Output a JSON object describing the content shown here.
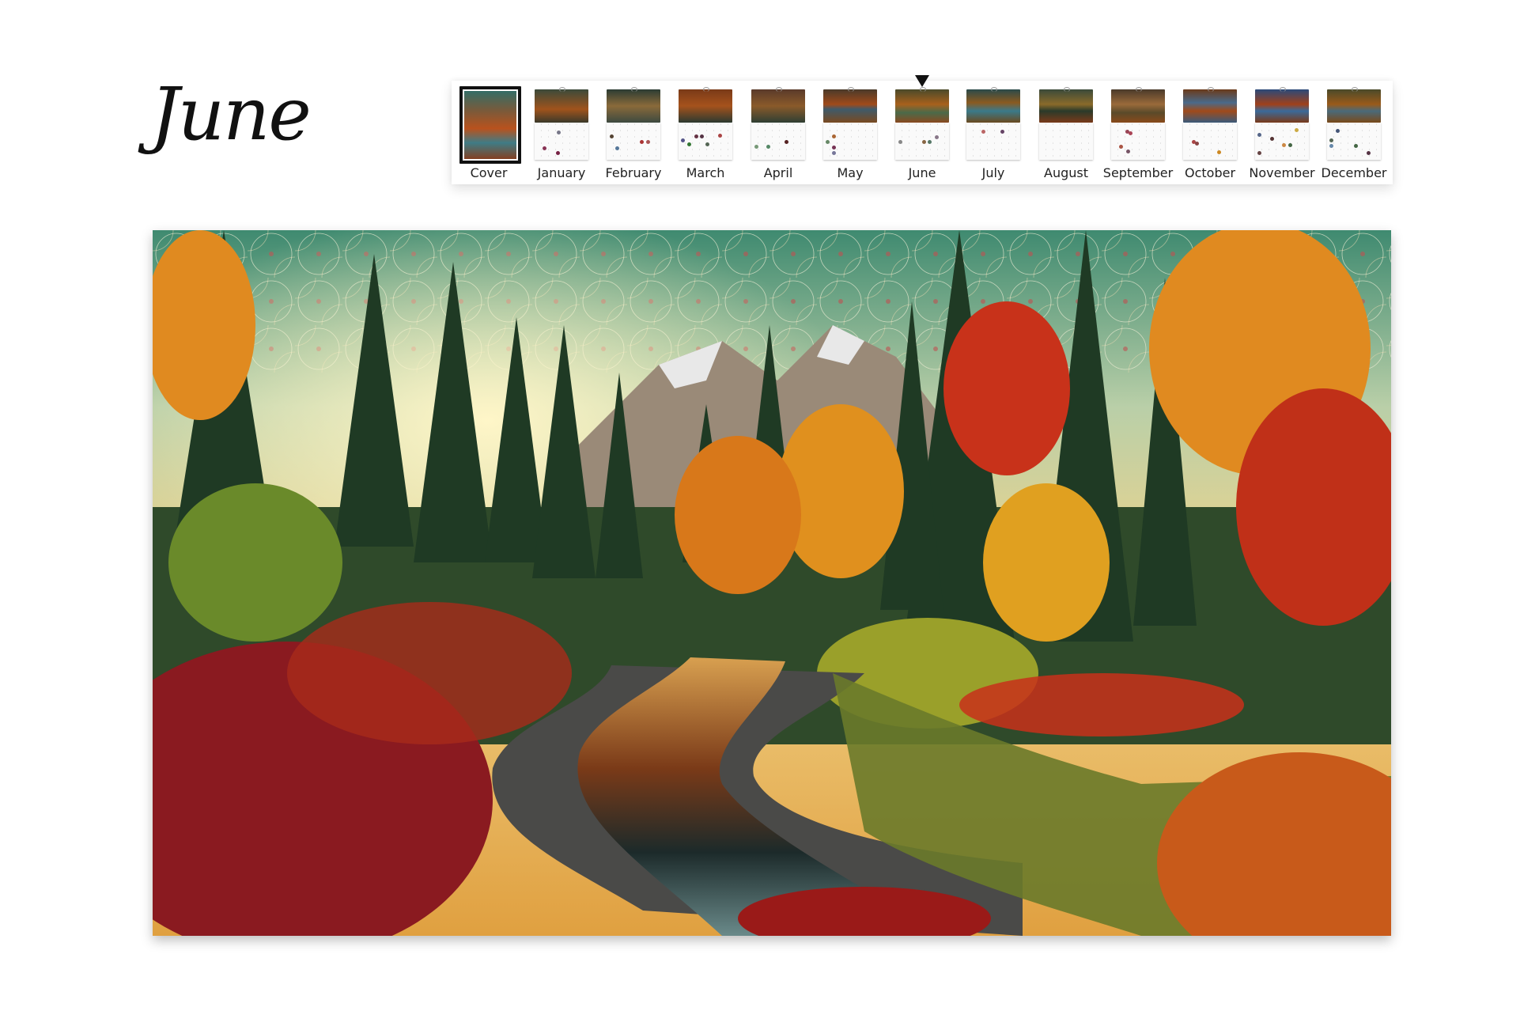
{
  "page": {
    "month_title": "June"
  },
  "strip": {
    "selected": "June",
    "items": [
      {
        "label": "Cover"
      },
      {
        "label": "January"
      },
      {
        "label": "February"
      },
      {
        "label": "March"
      },
      {
        "label": "April"
      },
      {
        "label": "May"
      },
      {
        "label": "June"
      },
      {
        "label": "July"
      },
      {
        "label": "August"
      },
      {
        "label": "September"
      },
      {
        "label": "October"
      },
      {
        "label": "November"
      },
      {
        "label": "December"
      }
    ]
  },
  "colors": {
    "selected_indicator": "#111111",
    "text": "#222222"
  }
}
